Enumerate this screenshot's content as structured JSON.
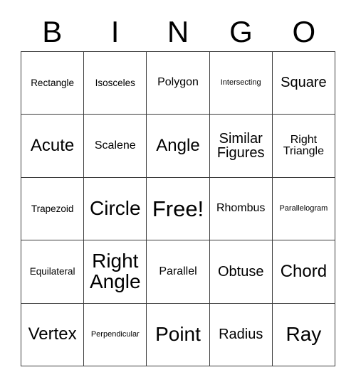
{
  "card": {
    "title": "BINGO",
    "header_letters": [
      "B",
      "I",
      "N",
      "G",
      "O"
    ],
    "free_space_label": "Free!",
    "colors": {
      "border": "#3b3b3b",
      "cell_background": "#ffffff",
      "text": "#000000",
      "page_background": "#ffffff"
    },
    "grid": {
      "rows": 5,
      "columns": 5
    },
    "cells": [
      {
        "label": "Rectangle",
        "size": "sm",
        "free": false
      },
      {
        "label": "Isosceles",
        "size": "sm",
        "free": false
      },
      {
        "label": "Polygon",
        "size": "md",
        "free": false
      },
      {
        "label": "Intersecting",
        "size": "xs",
        "free": false
      },
      {
        "label": "Square",
        "size": "lg",
        "free": false
      },
      {
        "label": "Acute",
        "size": "xl",
        "free": false
      },
      {
        "label": "Scalene",
        "size": "md",
        "free": false
      },
      {
        "label": "Angle",
        "size": "xl",
        "free": false
      },
      {
        "label": "Similar Figures",
        "size": "lg",
        "free": false
      },
      {
        "label": "Right Triangle",
        "size": "md",
        "free": false
      },
      {
        "label": "Trapezoid",
        "size": "sm",
        "free": false
      },
      {
        "label": "Circle",
        "size": "xxl",
        "free": false
      },
      {
        "label": "Free!",
        "size": "xxxl",
        "free": true
      },
      {
        "label": "Rhombus",
        "size": "md",
        "free": false
      },
      {
        "label": "Parallelogram",
        "size": "xs",
        "free": false
      },
      {
        "label": "Equilateral",
        "size": "sm",
        "free": false
      },
      {
        "label": "Right Angle",
        "size": "xxl",
        "free": false
      },
      {
        "label": "Parallel",
        "size": "md",
        "free": false
      },
      {
        "label": "Obtuse",
        "size": "lg",
        "free": false
      },
      {
        "label": "Chord",
        "size": "xl",
        "free": false
      },
      {
        "label": "Vertex",
        "size": "xl",
        "free": false
      },
      {
        "label": "Perpendicular",
        "size": "xs",
        "free": false
      },
      {
        "label": "Point",
        "size": "xxl",
        "free": false
      },
      {
        "label": "Radius",
        "size": "lg",
        "free": false
      },
      {
        "label": "Ray",
        "size": "xxl",
        "free": false
      }
    ]
  }
}
